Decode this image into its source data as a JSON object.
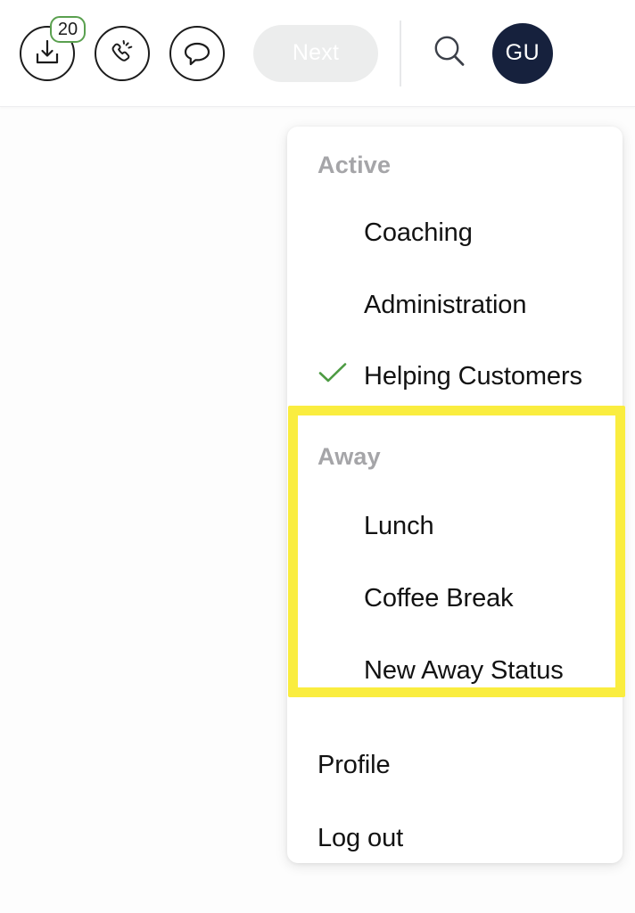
{
  "header": {
    "inbox": {
      "icon": "inbox-tray-download-icon",
      "badge_count": "20"
    },
    "call": {
      "icon": "phone-ringing-icon"
    },
    "chat": {
      "icon": "chat-bubble-icon"
    },
    "next_button": {
      "label": "Next",
      "state": "disabled"
    },
    "search": {
      "icon": "search-icon"
    },
    "avatar": {
      "initials": "GU"
    }
  },
  "dropdown": {
    "sections": [
      {
        "id": "active",
        "title": "Active",
        "options": [
          {
            "label": "Coaching",
            "checked": false
          },
          {
            "label": "Administration",
            "checked": false
          },
          {
            "label": "Helping Customers",
            "checked": true
          }
        ]
      },
      {
        "id": "away",
        "title": "Away",
        "highlighted": true,
        "options": [
          {
            "label": "Lunch",
            "checked": false
          },
          {
            "label": "Coffee Break",
            "checked": false
          },
          {
            "label": "New Away Status",
            "checked": false
          }
        ]
      }
    ],
    "footer_items": [
      {
        "label": "Profile"
      },
      {
        "label": "Log out"
      }
    ]
  },
  "colors": {
    "avatar_navy": "#16213d",
    "badge_green": "#5aa04f",
    "check_green": "#4d9b43",
    "highlight_yellow": "#faed3f",
    "section_header_gray": "#a5a5a8",
    "next_disabled_bg": "#eceded"
  }
}
